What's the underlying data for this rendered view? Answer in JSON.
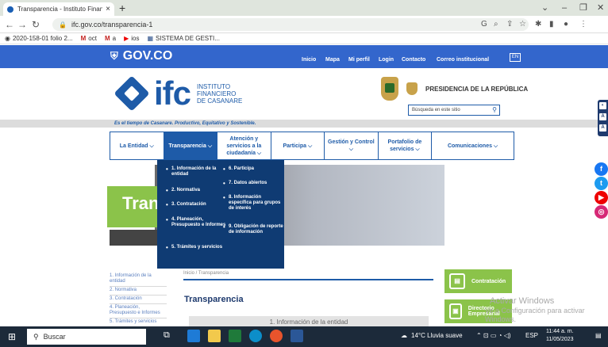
{
  "browser": {
    "tab_title": "Transparencia - Instituto Financié",
    "new_tab": "+",
    "url": "ifc.gov.co/transparencia-1",
    "bookmarks": [
      "2020-158-01 folio 2...",
      "oct",
      "a",
      "ios",
      "SISTEMA DE GESTI..."
    ]
  },
  "gov": {
    "logo": "GOV.CO",
    "nav": [
      "Inicio",
      "Mapa",
      "Mi perfil",
      "Login",
      "Contacto",
      "Correo institucional"
    ],
    "lang": "EN"
  },
  "header": {
    "ifc": "ifc",
    "ifc_line1": "INSTITUTO",
    "ifc_line2": "FINANCIERO",
    "ifc_line3": "DE CASANARE",
    "presidencia": "PRESIDENCIA DE LA REPÚBLICA",
    "search_placeholder": "Búsqueda en este sitio",
    "slogan": "Es el tiempo de Casanare. Productivo, Equitativo y Sostenible."
  },
  "menu": [
    "La Entidad ⌵",
    "Transparencia ⌵",
    "Atención y servicios a la ciudadanía ⌵",
    "Participa ⌵",
    "Gestión y Control ⌵",
    "Portafolio de servicios ⌵",
    "Comunicaciones ⌵"
  ],
  "dropdown": {
    "left": [
      "1. Información de la entidad",
      "2. Normativa",
      "3. Contratación",
      "4. Planeación, Presupuesto e Informes",
      "5. Trámites y servicios"
    ],
    "right": [
      "6. Participa",
      "7. Datos abiertos",
      "8. Información específica para grupos de interés",
      "9. Obligación de reporte de información"
    ]
  },
  "hero_title": "Tran",
  "sidebar": [
    "1. Información de la entidad",
    "2. Normativa",
    "3. Contratación",
    "4. Planeación, Presupuesto e Informes",
    "5. Trámites y servicios"
  ],
  "breadcrumb": "Inicio  /  Transparencia",
  "page_title": "Transparencia",
  "section_label": "1. Información de la entidad",
  "right_buttons": [
    "Contratación",
    "Directorio Empresarial"
  ],
  "watermark": [
    "Activar Windows",
    "Ve a Configuración para activar Windows."
  ],
  "taskbar": {
    "search": "Buscar",
    "weather": "14°C  Lluvia suave",
    "lang": "ESP",
    "time": "11:44 a. m.",
    "date": "11/05/2023"
  }
}
